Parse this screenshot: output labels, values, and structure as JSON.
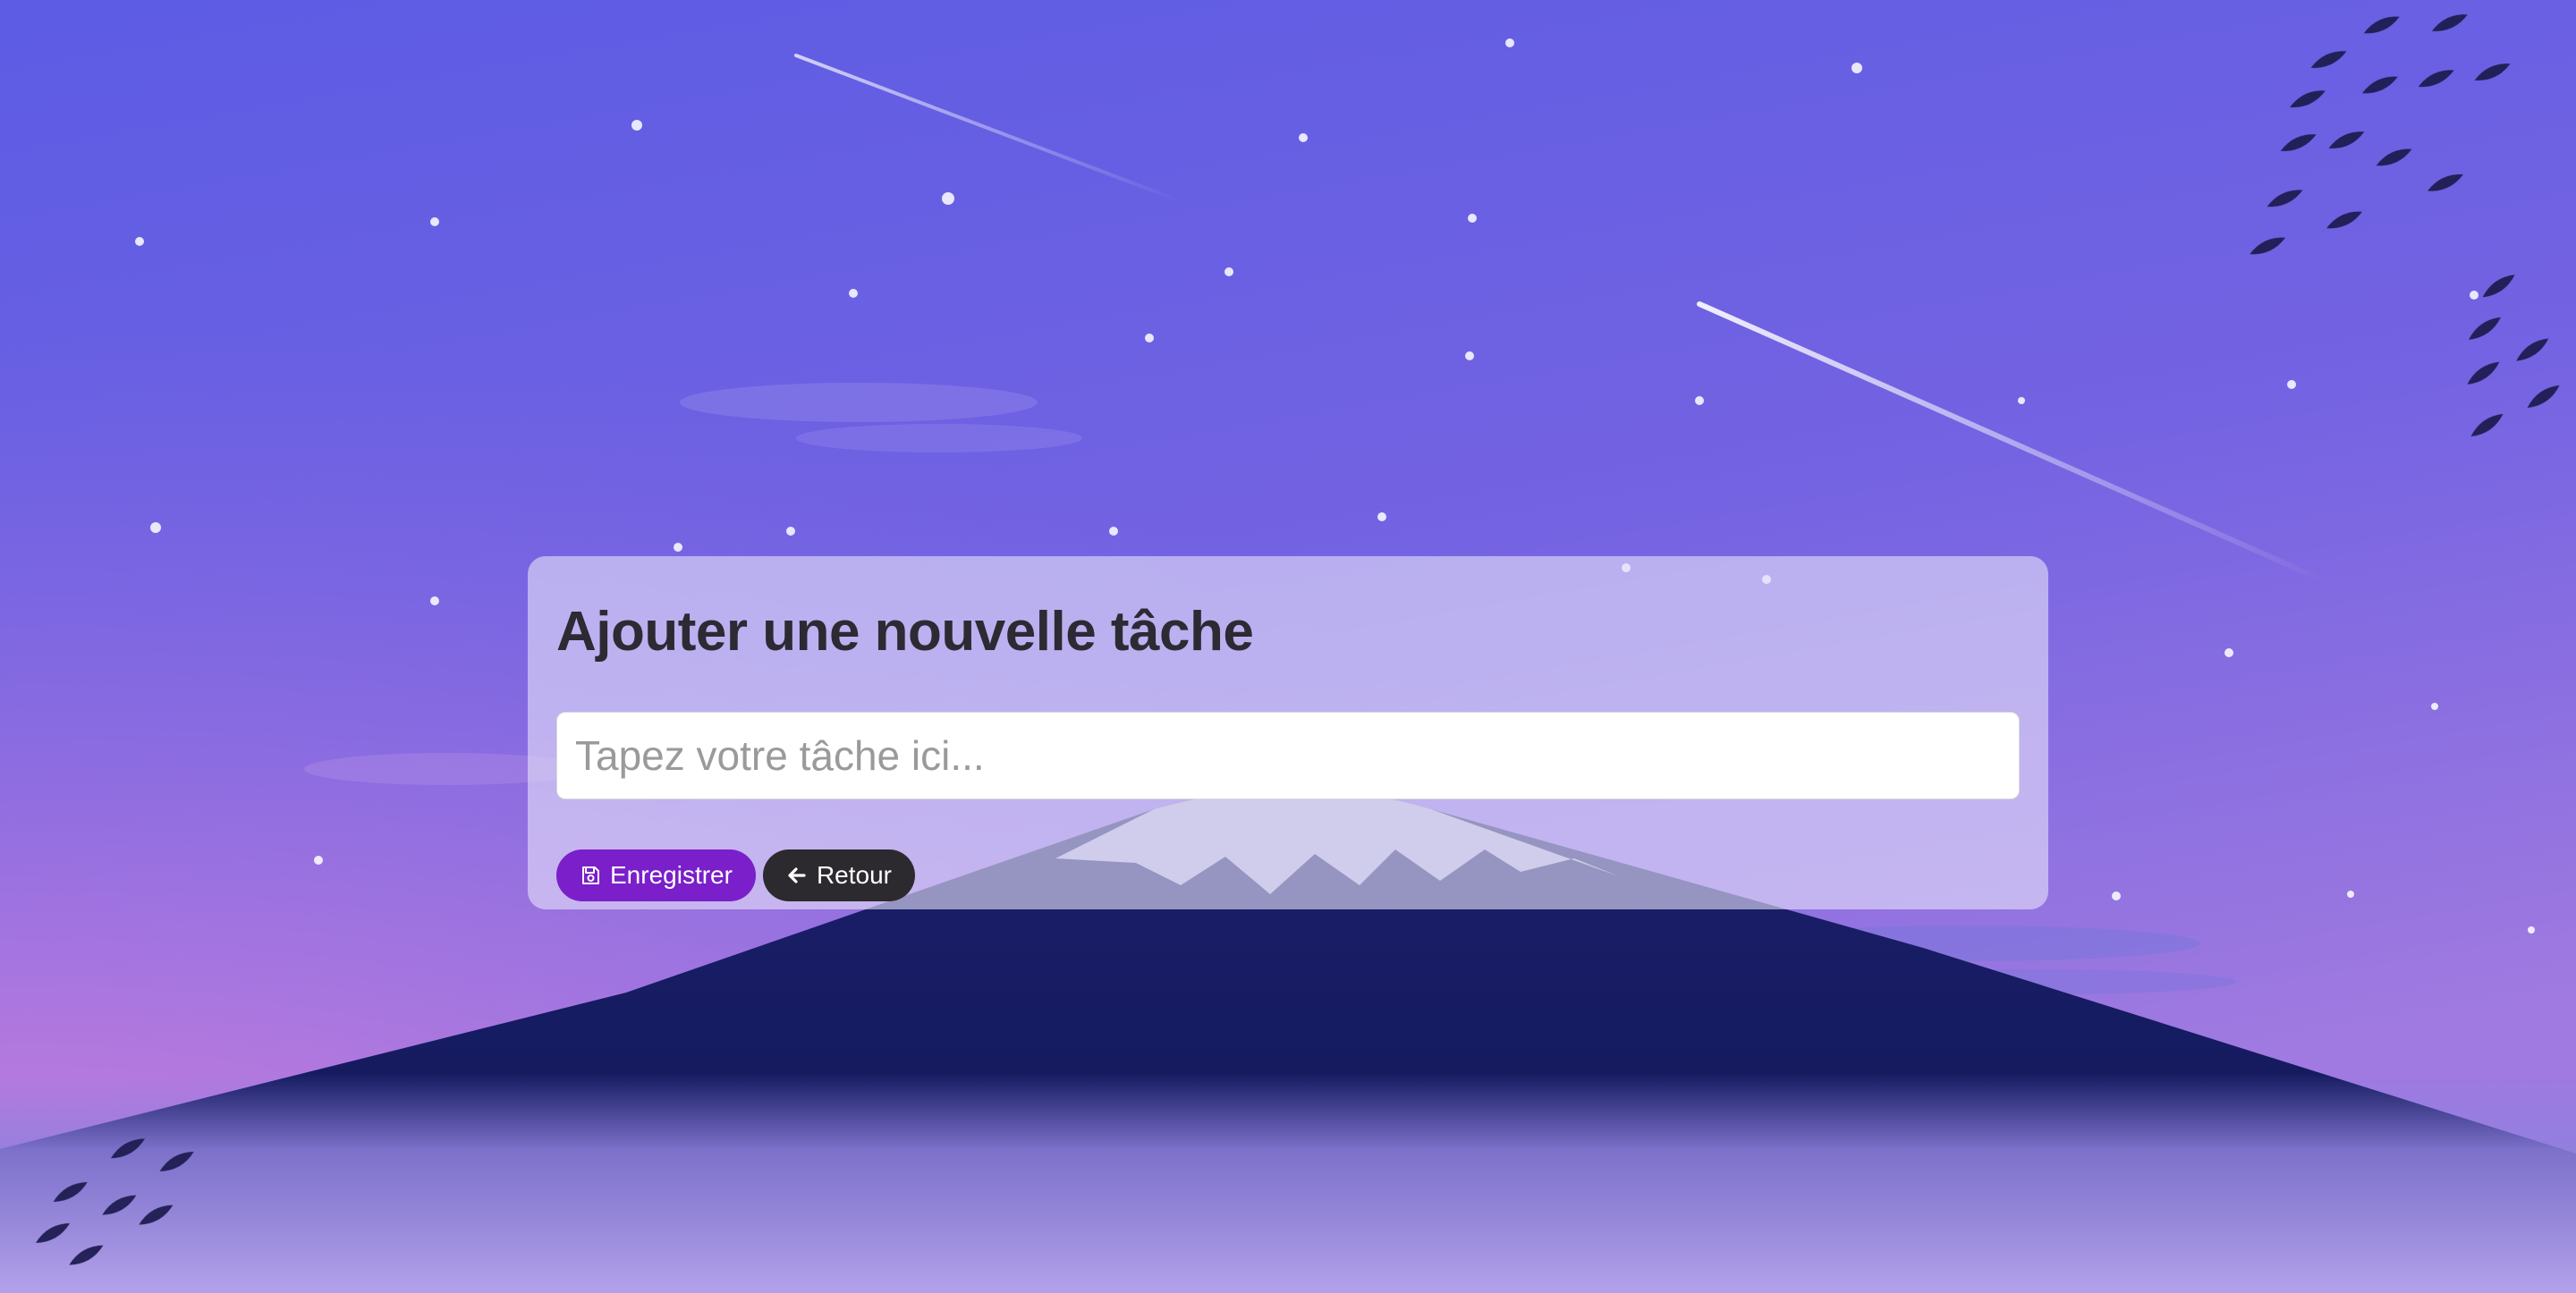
{
  "form": {
    "title": "Ajouter une nouvelle tâche",
    "input_placeholder": "Tapez votre tâche ici...",
    "input_value": "",
    "save_label": "Enregistrer",
    "back_label": "Retour",
    "save_icon": "save-icon",
    "back_icon": "arrow-left-icon"
  },
  "colors": {
    "save_button": "#7a1fc9",
    "back_button": "#2c2a2e",
    "sky_top": "#5b5de3",
    "sky_bottom_left": "#c77fdc",
    "mountain": "#131a5c"
  }
}
